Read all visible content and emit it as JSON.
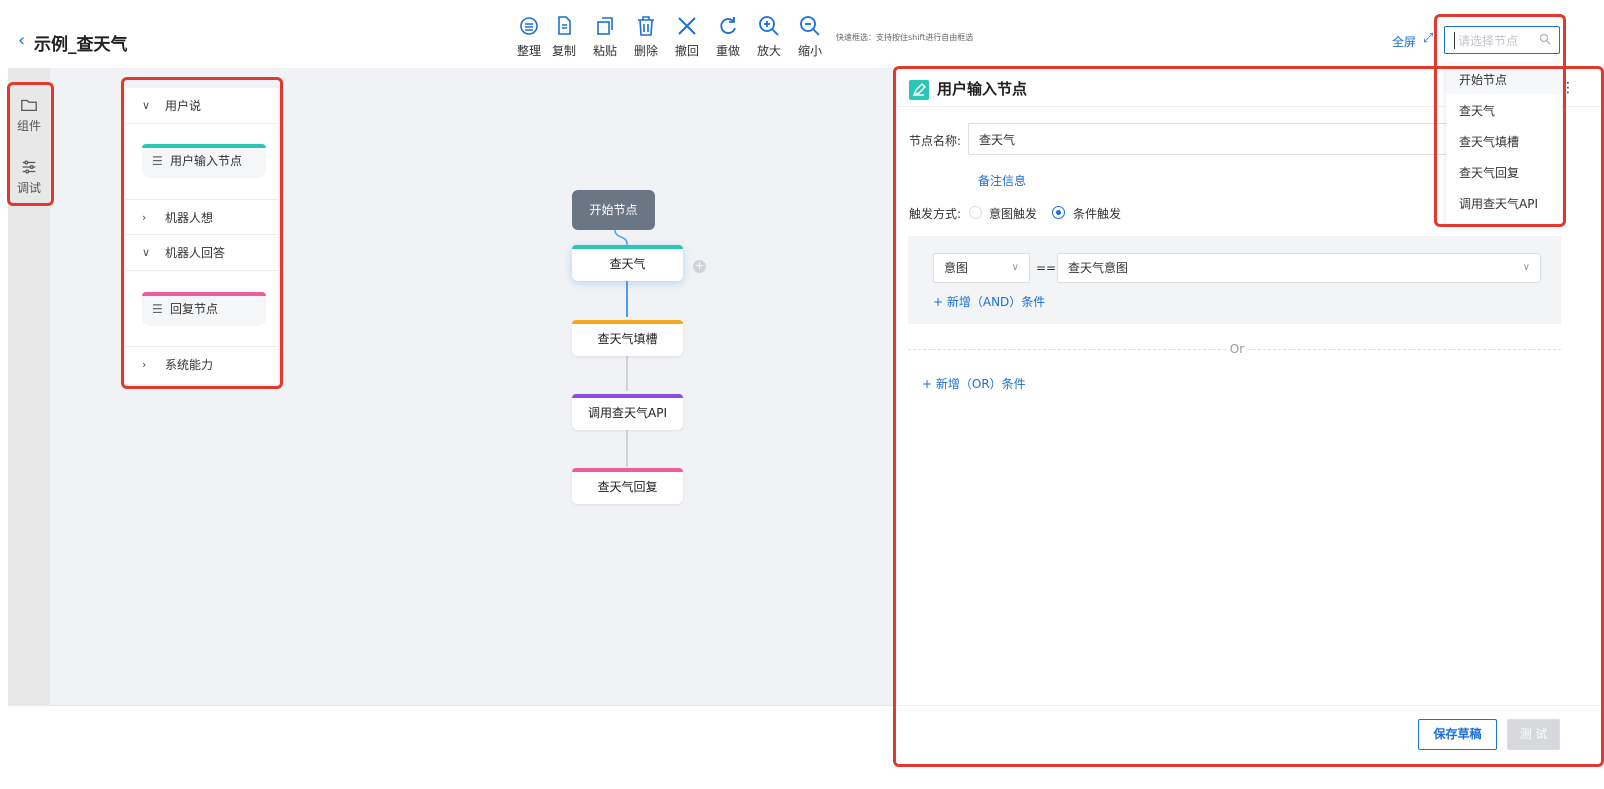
{
  "header": {
    "back_icon": "chevron-left-icon",
    "title": "示例_查天气",
    "toolbar": [
      {
        "label": "整理",
        "icon": "arrange-icon"
      },
      {
        "label": "复制",
        "icon": "copy-icon"
      },
      {
        "label": "粘贴",
        "icon": "paste-icon"
      },
      {
        "label": "删除",
        "icon": "trash-icon"
      },
      {
        "label": "撤回",
        "icon": "close-icon"
      },
      {
        "label": "重做",
        "icon": "redo-icon"
      },
      {
        "label": "放大",
        "icon": "zoom-in-icon"
      },
      {
        "label": "缩小",
        "icon": "zoom-out-icon"
      }
    ],
    "hint": "快速框选：支持按住shift进行自由框选",
    "fullscreen_label": "全屏",
    "search": {
      "placeholder": "请选择节点",
      "value": "",
      "options": [
        "开始节点",
        "查天气",
        "查天气填槽",
        "查天气回复",
        "调用查天气API"
      ]
    }
  },
  "rail": {
    "components_label": "组件",
    "debug_label": "调试"
  },
  "components": {
    "sections": [
      {
        "label": "用户说",
        "expanded": true
      },
      {
        "label": "机器人想",
        "expanded": false
      },
      {
        "label": "机器人回答",
        "expanded": true
      },
      {
        "label": "系统能力",
        "expanded": false
      }
    ],
    "user_input_card": "用户输入节点",
    "reply_card": "回复节点"
  },
  "flow": {
    "start": "开始节点",
    "nodes": [
      {
        "label": "查天气",
        "color": "#2bc6b6"
      },
      {
        "label": "查天气填槽",
        "color": "#f5a623"
      },
      {
        "label": "调用查天气API",
        "color": "#8a4fdb"
      },
      {
        "label": "查天气回复",
        "color": "#f05b9e"
      }
    ],
    "add_button": "+"
  },
  "properties": {
    "title": "用户输入节点",
    "node_name_label": "节点名称:",
    "node_name_value": "查天气",
    "remark_link": "备注信息",
    "trigger_label": "触发方式:",
    "trigger_options": [
      {
        "label": "意图触发",
        "selected": false
      },
      {
        "label": "条件触发",
        "selected": true
      }
    ],
    "condition": {
      "type": "意图",
      "operator": "==",
      "value": "查天气意图"
    },
    "add_and": "+ 新增（AND）条件",
    "or_label": "Or",
    "add_or": "+ 新增（OR）条件",
    "save_button": "保存草稿",
    "test_button": "测 试"
  },
  "colors": {
    "accent": "#1b6fd8",
    "highlight": "#e0392f",
    "start_node": "#6b7685"
  }
}
